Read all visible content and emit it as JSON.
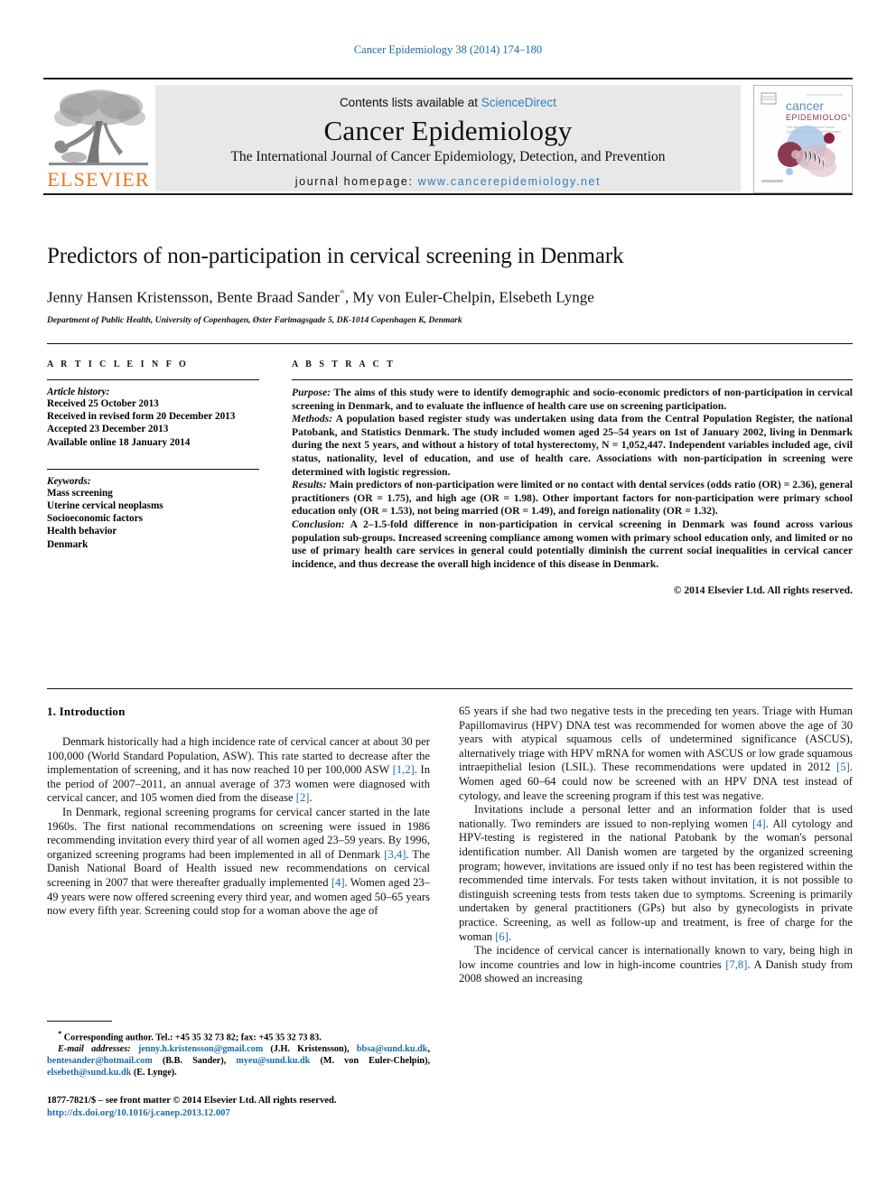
{
  "running_head": "Cancer Epidemiology 38 (2014) 174–180",
  "header": {
    "contents_prefix": "Contents lists available at ",
    "sciencedirect": "ScienceDirect",
    "journal_title": "Cancer Epidemiology",
    "journal_subtitle": "The International Journal of Cancer Epidemiology, Detection, and Prevention",
    "homepage_prefix": "journal homepage: ",
    "homepage_url": "www.cancerepidemiology.net",
    "publisher_logo_text": "ELSEVIER",
    "cover": {
      "title_line1": "cancer",
      "title_line2": "EPIDEMIOLOGY",
      "subtitle": "The International Journal of Cancer Epidemiology, Detection and Prevention"
    },
    "colors": {
      "link": "#2b7fc4",
      "elsevier_orange": "#e87722",
      "band_bg": "#e8e8e8"
    }
  },
  "article": {
    "title": "Predictors of non-participation in cervical screening in Denmark",
    "authors": "Jenny Hansen Kristensson, Bente Braad Sander",
    "authors_rest": ", My von Euler-Chelpin, Elsebeth Lynge",
    "corresponding_marker": "*",
    "affiliation": "Department of Public Health, University of Copenhagen, Øster Farimagsgade 5, DK-1014 Copenhagen K, Denmark"
  },
  "info": {
    "heading": "A R T I C L E   I N F O",
    "history_title": "Article history:",
    "history": [
      "Received 25 October 2013",
      "Received in revised form 20 December 2013",
      "Accepted 23 December 2013",
      "Available online 18 January 2014"
    ],
    "keywords_title": "Keywords:",
    "keywords": [
      "Mass screening",
      "Uterine cervical neoplasms",
      "Socioeconomic factors",
      "Health behavior",
      "Denmark"
    ]
  },
  "abstract": {
    "heading": "A B S T R A C T",
    "purpose_label": "Purpose:",
    "purpose_text": " The aims of this study were to identify demographic and socio-economic predictors of non-participation in cervical screening in Denmark, and to evaluate the influence of health care use on screening participation.",
    "methods_label": "Methods:",
    "methods_text": " A population based register study was undertaken using data from the Central Population Register, the national Patobank, and Statistics Denmark. The study included women aged 25–54 years on 1st of January 2002, living in Denmark during the next 5 years, and without a history of total hysterectomy, N = 1,052,447. Independent variables included age, civil status, nationality, level of education, and use of health care. Associations with non-participation in screening were determined with logistic regression.",
    "results_label": "Results:",
    "results_text": " Main predictors of non-participation were limited or no contact with dental services (odds ratio (OR) = 2.36), general practitioners (OR = 1.75), and high age (OR = 1.98). Other important factors for non-participation were primary school education only (OR = 1.53), not being married (OR = 1.49), and foreign nationality (OR = 1.32).",
    "conclusion_label": "Conclusion:",
    "conclusion_text": " A 2–1.5-fold difference in non-participation in cervical screening in Denmark was found across various population sub-groups. Increased screening compliance among women with primary school education only, and limited or no use of primary health care services in general could potentially diminish the current social inequalities in cervical cancer incidence, and thus decrease the overall high incidence of this disease in Denmark.",
    "copyright": "© 2014 Elsevier Ltd. All rights reserved."
  },
  "body": {
    "section_heading": "1. Introduction",
    "left_paragraphs": [
      {
        "parts": [
          {
            "t": "Denmark historically had a high incidence rate of cervical cancer at about 30 per 100,000 (World Standard Population, ASW). This rate started to decrease after the implementation of screening, and it has now reached 10 per 100,000 ASW "
          },
          {
            "t": "[1,2]",
            "ref": true
          },
          {
            "t": ". In the period of 2007–2011, an annual average of 373 women were diagnosed with cervical cancer, and 105 women died from the disease "
          },
          {
            "t": "[2]",
            "ref": true
          },
          {
            "t": "."
          }
        ]
      },
      {
        "parts": [
          {
            "t": "In Denmark, regional screening programs for cervical cancer started in the late 1960s. The first national recommendations on screening were issued in 1986 recommending invitation every third year of all women aged 23–59 years. By 1996, organized screening programs had been implemented in all of Denmark "
          },
          {
            "t": "[3,4]",
            "ref": true
          },
          {
            "t": ". The Danish National Board of Health issued new recommendations on cervical screening in 2007 that were thereafter gradually implemented "
          },
          {
            "t": "[4]",
            "ref": true
          },
          {
            "t": ". Women aged 23–49 years were now offered screening every third year, and women aged 50–65 years now every fifth year. Screening could stop for a woman above the age of"
          }
        ]
      }
    ],
    "right_paragraphs": [
      {
        "no_indent": true,
        "parts": [
          {
            "t": "65 years if she had two negative tests in the preceding ten years. Triage with Human Papillomavirus (HPV) DNA test was recommended for women above the age of 30 years with atypical squamous cells of undetermined significance (ASCUS), alternatively triage with HPV mRNA for women with ASCUS or low grade squamous intraepithelial lesion (LSIL). These recommendations were updated in 2012 "
          },
          {
            "t": "[5]",
            "ref": true
          },
          {
            "t": ". Women aged 60–64 could now be screened with an HPV DNA test instead of cytology, and leave the screening program if this test was negative."
          }
        ]
      },
      {
        "parts": [
          {
            "t": "Invitations include a personal letter and an information folder that is used nationally. Two reminders are issued to non-replying women "
          },
          {
            "t": "[4]",
            "ref": true
          },
          {
            "t": ". All cytology and HPV-testing is registered in the national Patobank by the woman's personal identification number. All Danish women are targeted by the organized screening program; however, invitations are issued only if no test has been registered within the recommended time intervals. For tests taken without invitation, it is not possible to distinguish screening tests from tests taken due to symptoms. Screening is primarily undertaken by general practitioners (GPs) but also by gynecologists in private practice. Screening, as well as follow-up and treatment, is free of charge for the woman "
          },
          {
            "t": "[6]",
            "ref": true
          },
          {
            "t": "."
          }
        ]
      },
      {
        "parts": [
          {
            "t": "The incidence of cervical cancer is internationally known to vary, being high in low income countries and low in high-income countries "
          },
          {
            "t": "[7,8]",
            "ref": true
          },
          {
            "t": ". A Danish study from 2008 showed an increasing"
          }
        ]
      }
    ]
  },
  "footnotes": {
    "corresponding_marker": "*",
    "corresponding": " Corresponding author. Tel.: +45 35 32 73 82; fax: +45 35 32 73 83.",
    "email_label": "E-mail addresses:",
    "emails": [
      {
        "addr": "jenny.h.kristensson@gmail.com",
        "name": " (J.H. Kristensson), "
      },
      {
        "addr": "bbsa@sund.ku.dk",
        "name": ", "
      },
      {
        "addr": "bentesander@hotmail.com",
        "name": " (B.B. Sander), "
      },
      {
        "addr": "myeu@sund.ku.dk",
        "name": " (M. von Euler-Chelpin), "
      },
      {
        "addr": "elsebeth@sund.ku.dk",
        "name": " (E. Lynge)."
      }
    ],
    "issn_line": "1877-7821/$ – see front matter © 2014 Elsevier Ltd. All rights reserved.",
    "doi": "http://dx.doi.org/10.1016/j.canep.2013.12.007"
  }
}
